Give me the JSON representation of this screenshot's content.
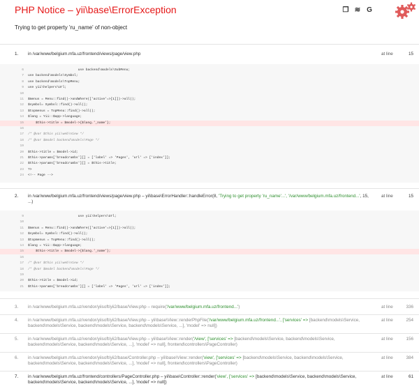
{
  "header": {
    "title_type": "PHP Notice",
    "title_dash": " – ",
    "title_exception": "yii\\base\\ErrorException",
    "message": "Trying to get property 'ru_name' of non-object",
    "tools": [
      {
        "name": "copy-icon",
        "glyph": "❐"
      },
      {
        "name": "stackoverflow-icon",
        "glyph": "≋"
      },
      {
        "name": "google-icon",
        "glyph": "G"
      }
    ]
  },
  "frames": [
    {
      "num": "1.",
      "path": "in /var/www/belgium.mfa.uz/frontend/views/page/view.php",
      "at": "at line",
      "line": "15",
      "code": [
        {
          "ln": "6",
          "text": "                          use backend\\models\\SubMenu;"
        },
        {
          "ln": "7",
          "text": "use backend\\models\\Symbol;"
        },
        {
          "ln": "8",
          "text": "use backend\\models\\TopMenu;"
        },
        {
          "ln": "9",
          "text": "use yii\\helpers\\Url;"
        },
        {
          "ln": "10",
          "text": ""
        },
        {
          "ln": "11",
          "text": "$menus = Menu::find()->andWhere(['active'=>[1]])->all();"
        },
        {
          "ln": "12",
          "text": "$symbol= Symbol::find()->all();"
        },
        {
          "ln": "13",
          "text": "$topmenus = TopMenu::find()->all();"
        },
        {
          "ln": "14",
          "text": "$lang = Yii::$app->language;"
        },
        {
          "ln": "15",
          "text": "    $this->title = $model->{$lang.'_name'};",
          "error": true
        },
        {
          "ln": "16",
          "text": ""
        },
        {
          "ln": "17",
          "text": "/* @var $this yii\\web\\View */",
          "comment": true
        },
        {
          "ln": "18",
          "text": "/* @var $model backend\\models\\Page */",
          "comment": true
        },
        {
          "ln": "19",
          "text": ""
        },
        {
          "ln": "20",
          "text": "$this->title = $model->id;"
        },
        {
          "ln": "21",
          "text": "$this->params['breadcrumbs'][] = ['label' => 'Pages', 'url' => ['index']];"
        },
        {
          "ln": "22",
          "text": "$this->params['breadcrumbs'][] = $this->title;"
        },
        {
          "ln": "23",
          "text": "?>"
        },
        {
          "ln": "24",
          "text": "<!-- Page -->"
        }
      ]
    },
    {
      "num": "2.",
      "path_a": "in /var/www/belgium.mfa.uz/frontend/views/page/view.php – yii\\base\\ErrorHandler::handleError(8, ",
      "path_b": "'Trying to get property 'ru_name'...', '/var/www/belgium.mfa.uz/frontend...'",
      "path_c": ", 15, ...)",
      "at": "at line",
      "line": "15",
      "code": [
        {
          "ln": "9",
          "text": "                          use yii\\helpers\\Url;"
        },
        {
          "ln": "10",
          "text": ""
        },
        {
          "ln": "11",
          "text": "$menus = Menu::find()->andWhere(['active'=>[1]])->all();"
        },
        {
          "ln": "12",
          "text": "$symbol= Symbol::find()->all();"
        },
        {
          "ln": "13",
          "text": "$topmenus = TopMenu::find()->all();"
        },
        {
          "ln": "14",
          "text": "$lang = Yii::$app->language;"
        },
        {
          "ln": "15",
          "text": "    $this->title = $model->{$lang.'_name'};",
          "error": true
        },
        {
          "ln": "16",
          "text": ""
        },
        {
          "ln": "17",
          "text": "/* @var $this yii\\web\\View */",
          "comment": true
        },
        {
          "ln": "18",
          "text": "/* @var $model backend\\models\\Page */",
          "comment": true
        },
        {
          "ln": "19",
          "text": ""
        },
        {
          "ln": "20",
          "text": "$this->title = $model->id;"
        },
        {
          "ln": "21",
          "text": "$this->params['breadcrumbs'][] = ['label' => 'Pages', 'url' => ['index']];"
        }
      ]
    },
    {
      "num": "3.",
      "path_a": "in /var/www/belgium.mfa.uz/vendor/yiisoft/yii2/base/View.php – require(",
      "path_b": "'/var/www/belgium.mfa.uz/frontend...'",
      "path_c": ")",
      "at": "at line",
      "line": "336"
    },
    {
      "num": "4.",
      "path_a": "in /var/www/belgium.mfa.uz/vendor/yiisoft/yii2/base/View.php – yii\\base\\View::renderPhpFile(",
      "path_b": "'/var/www/belgium.mfa.uz/frontend...', ['services' =>",
      "path_c": "[backend\\models\\Service, backend\\models\\Service, backend\\models\\Service, backend\\models\\Service, ...], 'model' => null])",
      "at": "at line",
      "line": "254"
    },
    {
      "num": "5.",
      "path_a": "in /var/www/belgium.mfa.uz/vendor/yiisoft/yii2/base/View.php – yii\\base\\View::render(",
      "path_b": "'/view', ['services' =>",
      "path_c": "[backend\\models\\Service, backend\\models\\Service, backend\\models\\Service, backend\\models\\Service, ...], 'model' => null], frontend\\controllers\\PageController)",
      "at": "at line",
      "line": "156"
    },
    {
      "num": "6.",
      "path_a": "in /var/www/belgium.mfa.uz/vendor/yiisoft/yii2/base/Controller.php – yii\\base\\View::render(",
      "path_b": "'view', ['services' =>",
      "path_c": "[backend\\models\\Service, backend\\models\\Service, backend\\models\\Service, backend\\models\\Service, ...], 'model' => null], frontend\\controllers\\PageController)",
      "at": "at line",
      "line": "384"
    },
    {
      "num": "7.",
      "path_a": "in /var/www/belgium.mfa.uz/frontend/controllers/PageController.php – yii\\base\\Controller::render(",
      "path_b": "'view', ['services' =>",
      "path_c": "[backend\\models\\Service, backend\\models\\Service, backend\\models\\Service, backend\\models\\Service, ...], 'model' => null])",
      "at": "at line",
      "line": "61"
    }
  ]
}
